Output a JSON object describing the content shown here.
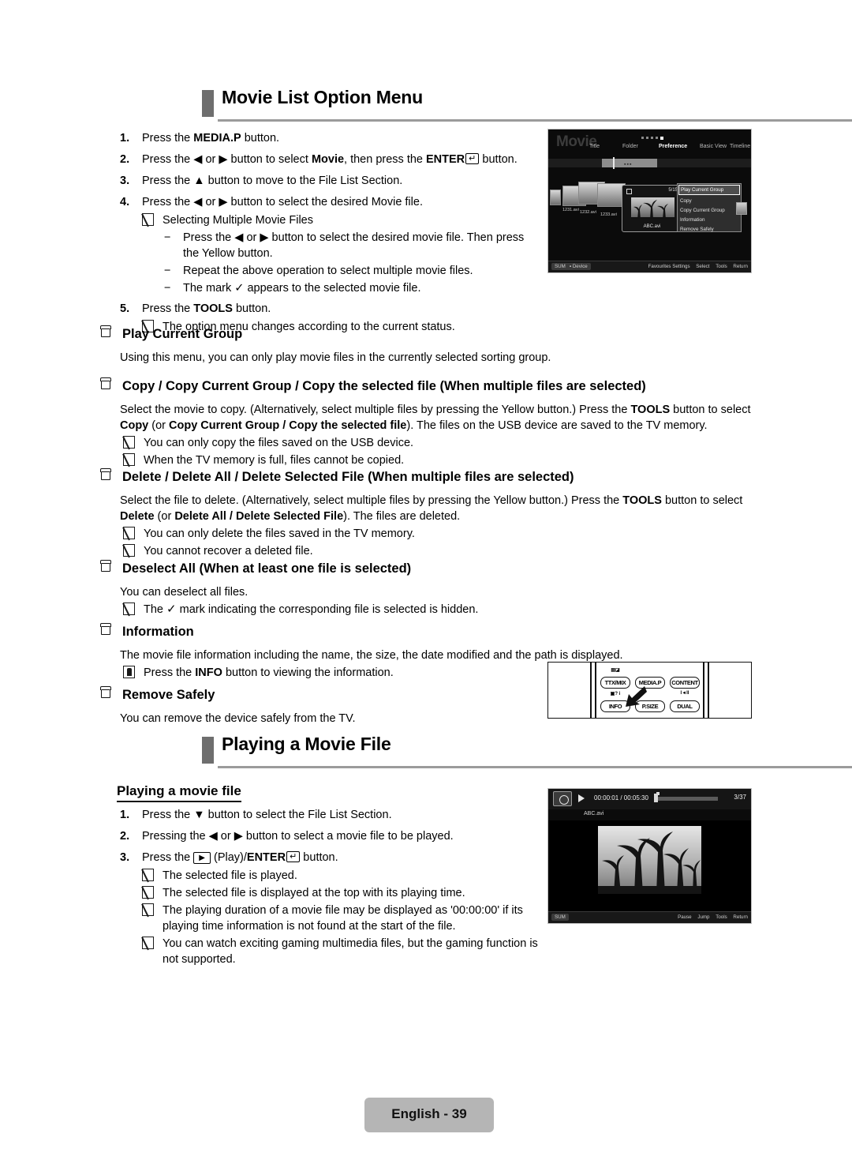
{
  "page": {
    "footer_label": "English - 39"
  },
  "section1": {
    "heading": "Movie List Option Menu",
    "steps": [
      {
        "num": "1.",
        "text_pre": "Press the ",
        "bold": "MEDIA.P",
        "text_post": " button."
      },
      {
        "num": "2.",
        "text_pre": "Press the ◀ or ▶ button to select ",
        "bold": "Movie",
        "text_post": ", then press the ",
        "bold2": "ENTER",
        "key": "↵",
        "text_end": " button."
      },
      {
        "num": "3.",
        "text_pre": "Press the ▲ button to move to the File List Section.",
        "bold": "",
        "text_post": ""
      },
      {
        "num": "4.",
        "text_pre": "Press the ◀ or ▶ button to select the desired Movie file.",
        "bold": "",
        "text_post": ""
      },
      {
        "num": "5.",
        "text_pre": "Press the ",
        "bold": "TOOLS",
        "text_post": " button."
      }
    ],
    "step4_note": "Selecting Multiple Movie Files",
    "step4_dashes": [
      "Press the ◀ or ▶ button to select the desired movie file. Then press the Yellow button.",
      "Repeat the above operation to select multiple movie files.",
      "The mark ✓ appears to the selected movie file."
    ],
    "step5_note": "The option menu changes according to the current status."
  },
  "subsections": [
    {
      "title": "Play Current Group",
      "body": "Using this menu, you can only play movie files in the currently selected sorting group.",
      "notes": []
    },
    {
      "title": "Copy / Copy Current Group / Copy the selected file (When multiple files are selected)",
      "body_p1_a": "Select the movie to copy. (Alternatively, select multiple files by pressing the Yellow button.) Press the ",
      "body_p1_b": "TOOLS",
      "body_p1_c": " button to select ",
      "body_p1_d": "Copy",
      "body_p1_e": " (or ",
      "body_p1_f": "Copy Current Group / Copy the selected file",
      "body_p1_g": "). The files on the USB device are saved to the TV memory.",
      "notes": [
        "You can only copy the files saved on the USB device.",
        "When the TV memory is full, files cannot be copied."
      ]
    },
    {
      "title": "Delete / Delete All / Delete Selected File (When multiple files are selected)",
      "body_p1_a": "Select the file to delete. (Alternatively, select multiple files by pressing the Yellow button.) Press the ",
      "body_p1_b": "TOOLS",
      "body_p1_c": " button to select ",
      "body_p1_d": "Delete",
      "body_p1_e": " (or ",
      "body_p1_f": "Delete All / Delete Selected File",
      "body_p1_g": "). The files are deleted.",
      "notes": [
        "You can only delete the files saved in the TV memory.",
        "You cannot recover a deleted file."
      ]
    },
    {
      "title": "Deselect All (When at least one file is selected)",
      "body": "You can deselect all files.",
      "note_pre": "The ",
      "note_check": "✓",
      "note_post": " mark indicating the corresponding file is selected is hidden."
    },
    {
      "title": "Information",
      "body": "The movie file information including the name, the size, the date modified and the path is displayed.",
      "note_pre": "Press the ",
      "note_bold": "INFO",
      "note_post": " button to viewing the information."
    },
    {
      "title": "Remove Safely",
      "body": "You can remove the device safely from the TV."
    }
  ],
  "section2": {
    "heading": "Playing a Movie File",
    "subheading": "Playing a movie file",
    "steps": [
      {
        "num": "1.",
        "text": "Press the ▼ button to select the File List Section."
      },
      {
        "num": "2.",
        "text": "Pressing the ◀ or ▶ button to select a movie file to be played."
      },
      {
        "num": "3.",
        "text_pre": "Press the ",
        "play_key": "▶",
        "text_mid": " (Play)/",
        "bold": "ENTER",
        "key": "↵",
        "text_post": " button."
      }
    ],
    "notes": [
      "The selected file is played.",
      "The selected file is displayed at the top with its playing time.",
      "The playing duration of a movie file may be displayed as '00:00:00' if its playing time information is not found at the start of the file.",
      "You can watch exciting gaming multimedia files, but the gaming function is not supported."
    ]
  },
  "tv_movie_list": {
    "brand": "Movie",
    "tabs": [
      "Title",
      "Folder",
      "Preference",
      "Basic View",
      "Timeline"
    ],
    "active_tab": "Preference",
    "thumbnails": [
      {
        "label": "1231.avi"
      },
      {
        "label": "1232.avi"
      },
      {
        "label": "1233.avi"
      }
    ],
    "selected": {
      "counter": "5/15",
      "name": "ABC.avi"
    },
    "context_menu": [
      "Play Current Group",
      "Copy",
      "Copy Current Group",
      "Information",
      "Remove Safely"
    ],
    "context_menu_active": "Play Current Group",
    "footer_left": [
      "SUM",
      "Device"
    ],
    "footer_right": [
      "Favourites Settings",
      "Select",
      "Tools",
      "Return"
    ]
  },
  "remote": {
    "buttons": [
      "TTX/MIX",
      "MEDIA.P",
      "CONTENT",
      "INFO",
      "P.SIZE",
      "DUAL"
    ],
    "top_labels": [
      "▤◪",
      "",
      "",
      "▣? i",
      "",
      "I◄II"
    ]
  },
  "tv_playback": {
    "elapsed_total": "00:00:01 / 00:05:30",
    "counter": "3/37",
    "filename": "ABC.avi",
    "footer_left": "SUM",
    "footer_right": [
      "Pause",
      "Jump",
      "Tools",
      "Return"
    ]
  }
}
